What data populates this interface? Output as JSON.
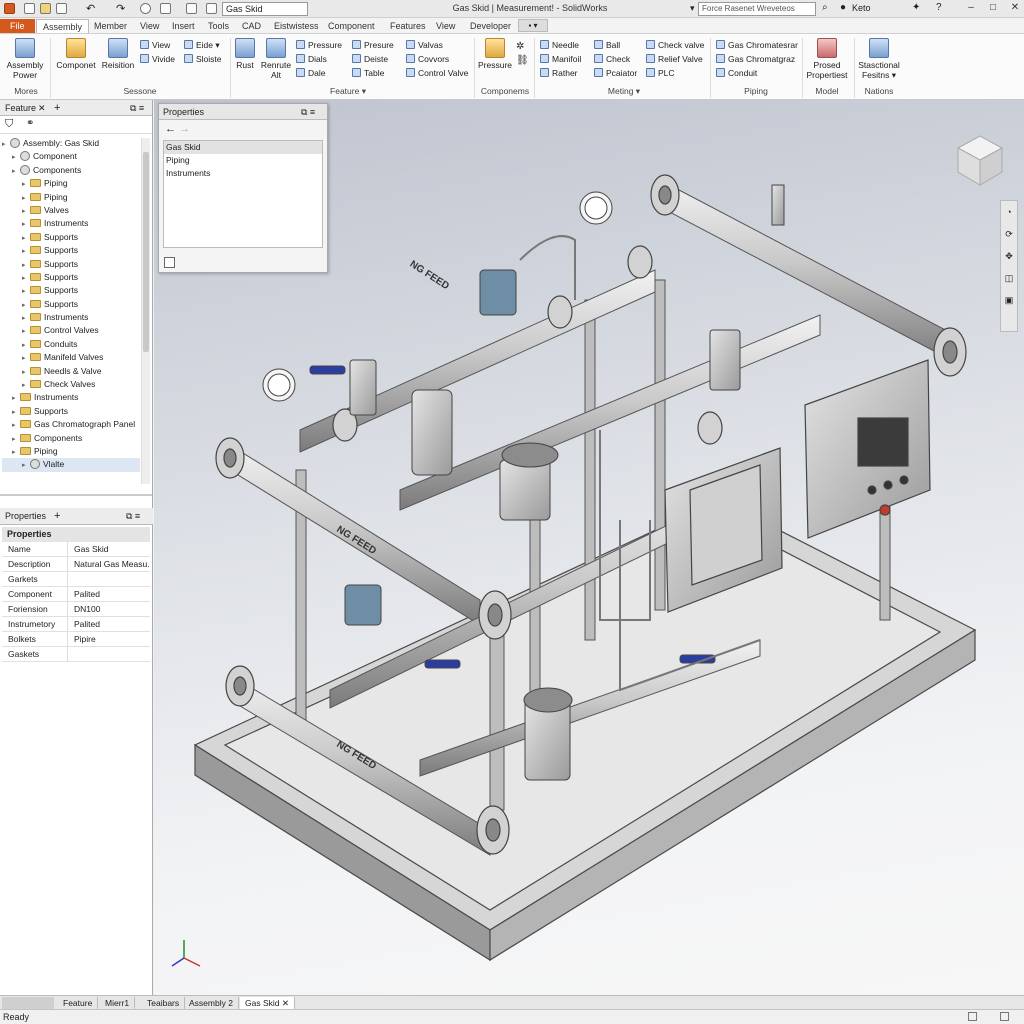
{
  "window": {
    "doc_combo": "Gas Skid",
    "title": "Gas Skid | Measurement! - SolidWorks",
    "search_placeholder": "Force Rasenet Wreveteos",
    "user": "Keto"
  },
  "menu": [
    "File",
    "Assembly",
    "Member",
    "View",
    "Insert",
    "Tools",
    "CAD",
    "Eistwistess",
    "Component",
    "Features",
    "View",
    "Developer"
  ],
  "ribbon": {
    "big": [
      "Assembly Power",
      "Componet",
      "Reisition",
      "Rust",
      "Renrute Alt",
      "Pressure",
      "Prosed Propertiest",
      "Stasctional Fesitns"
    ],
    "col1": [
      "View",
      "Vivide"
    ],
    "col2": [
      "Eide",
      "Sloiste"
    ],
    "col3": [
      "Pressure",
      "Dials",
      "Dale"
    ],
    "col4": [
      "Presure",
      "Deiste",
      "Table"
    ],
    "col5": [
      "Valvas",
      "Covvors",
      "Control Valve"
    ],
    "col6": [
      "Needle",
      "Manifoil",
      "Rather"
    ],
    "col7": [
      "Ball",
      "Check",
      "Pcaiator"
    ],
    "col8": [
      "Check valve",
      "Relief Valve",
      "PLC"
    ],
    "col9": [
      "Gas Chromatesrar",
      "Gas Chromatgraz",
      "Conduit"
    ],
    "groups": [
      "Mores",
      "Sessone",
      "Feature",
      "Componems",
      "Meting",
      "Piping",
      "Model",
      "Nations"
    ]
  },
  "feature_panel": {
    "tab": "Feature",
    "tree": [
      {
        "label": "Assembly: Gas Skid",
        "level": 0,
        "icon": "asm"
      },
      {
        "label": "Component",
        "level": 1,
        "icon": "asm"
      },
      {
        "label": "Components",
        "level": 1,
        "icon": "asm"
      },
      {
        "label": "Piping",
        "level": 2,
        "icon": "folder"
      },
      {
        "label": "Piping",
        "level": 2,
        "icon": "folder"
      },
      {
        "label": "Valves",
        "level": 2,
        "icon": "folder"
      },
      {
        "label": "Instruments",
        "level": 2,
        "icon": "folder"
      },
      {
        "label": "Supports",
        "level": 2,
        "icon": "folder"
      },
      {
        "label": "Supports",
        "level": 2,
        "icon": "folder"
      },
      {
        "label": "Supports",
        "level": 2,
        "icon": "folder"
      },
      {
        "label": "Supports",
        "level": 2,
        "icon": "folder"
      },
      {
        "label": "Supports",
        "level": 2,
        "icon": "folder"
      },
      {
        "label": "Supports",
        "level": 2,
        "icon": "folder"
      },
      {
        "label": "Instruments",
        "level": 2,
        "icon": "folder"
      },
      {
        "label": "Control Valves",
        "level": 2,
        "icon": "folder"
      },
      {
        "label": "Conduits",
        "level": 2,
        "icon": "folder"
      },
      {
        "label": "Manifeld Valves",
        "level": 2,
        "icon": "folder"
      },
      {
        "label": "Needls & Valve",
        "level": 2,
        "icon": "folder"
      },
      {
        "label": "Check Valves",
        "level": 2,
        "icon": "folder"
      },
      {
        "label": "Instruments",
        "level": 1,
        "icon": "folder"
      },
      {
        "label": "Supports",
        "level": 1,
        "icon": "folder"
      },
      {
        "label": "Gas Chromatograph Panel",
        "level": 1,
        "icon": "folder"
      },
      {
        "label": "Components",
        "level": 1,
        "icon": "folder"
      },
      {
        "label": "Piping",
        "level": 1,
        "icon": "folder"
      },
      {
        "label": "Vlalte",
        "level": 2,
        "icon": "asm"
      }
    ]
  },
  "float_props": {
    "tab": "Properties",
    "items": [
      "Gas Skid",
      "Piping",
      "Instruments"
    ]
  },
  "properties": {
    "tab": "Properties",
    "header": "Properties",
    "rows": [
      {
        "k": "Name",
        "v": "Gas Skid"
      },
      {
        "k": "Description",
        "v": "Natural Gas Measu..."
      },
      {
        "k": "Garkets",
        "v": ""
      },
      {
        "k": "Component",
        "v": "Palited"
      },
      {
        "k": "Foriension",
        "v": "DN100"
      },
      {
        "k": "Instrumetory",
        "v": "Palited"
      },
      {
        "k": "Bolkets",
        "v": "Pipire"
      },
      {
        "k": "Gaskets",
        "v": ""
      }
    ]
  },
  "viewport": {
    "labels": [
      "NG FEED",
      "NG FEED",
      "NG FEED"
    ]
  },
  "bottom_tabs": [
    "Feature",
    "Mierr1",
    "Teaibars",
    "Assembly 2",
    "Gas Skid"
  ],
  "status": "Ready"
}
